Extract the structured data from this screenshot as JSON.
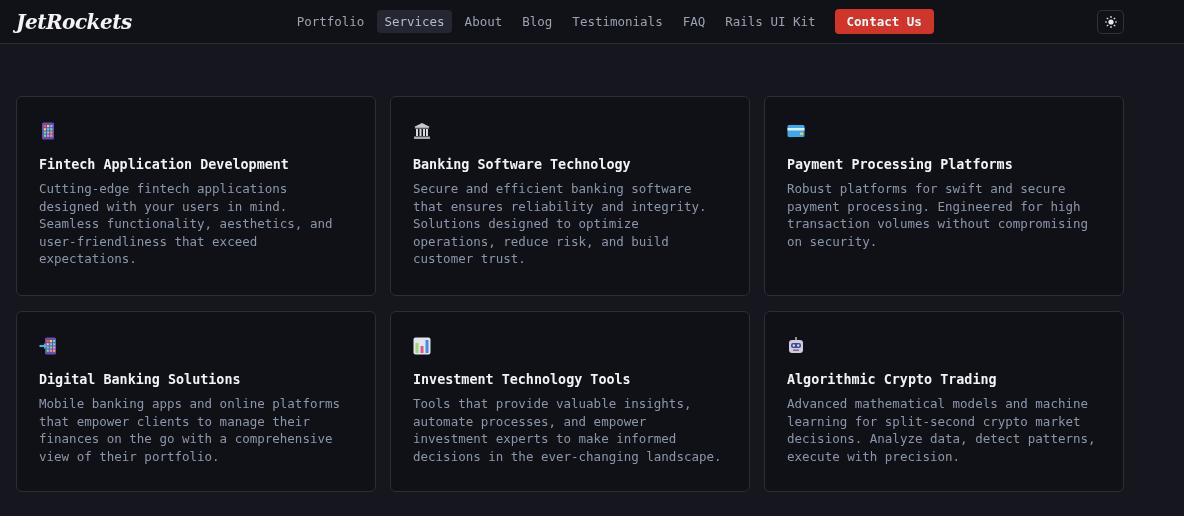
{
  "header": {
    "logo": "JetRockets",
    "nav": [
      {
        "label": "Portfolio",
        "selected": false
      },
      {
        "label": "Services",
        "selected": true
      },
      {
        "label": "About",
        "selected": false
      },
      {
        "label": "Blog",
        "selected": false
      },
      {
        "label": "Testimonials",
        "selected": false
      },
      {
        "label": "FAQ",
        "selected": false
      },
      {
        "label": "Rails UI Kit",
        "selected": false
      }
    ],
    "cta": "Contact Us"
  },
  "cards": [
    {
      "title": "Fintech Application Development",
      "description": "Cutting-edge fintech applications designed with your users in mind. Seamless functionality, aesthetics, and user-friendliness that exceed expectations."
    },
    {
      "title": "Banking Software Technology",
      "description": "Secure and efficient banking software that ensures reliability and integrity. Solutions designed to optimize operations, reduce risk, and build customer trust."
    },
    {
      "title": "Payment Processing Platforms",
      "description": "Robust platforms for swift and secure payment processing. Engineered for high transaction volumes without compromising on security."
    },
    {
      "title": "Digital Banking Solutions",
      "description": "Mobile banking apps and online platforms that empower clients to manage their finances on the go with a comprehensive view of their portfolio."
    },
    {
      "title": "Investment Technology Tools",
      "description": "Tools that provide valuable insights, automate processes, and empower investment experts to make informed decisions in the ever-changing landscape."
    },
    {
      "title": "Algorithmic Crypto Trading",
      "description": "Advanced mathematical models and machine learning for split-second crypto market decisions. Analyze data, detect patterns, execute with precision."
    }
  ]
}
